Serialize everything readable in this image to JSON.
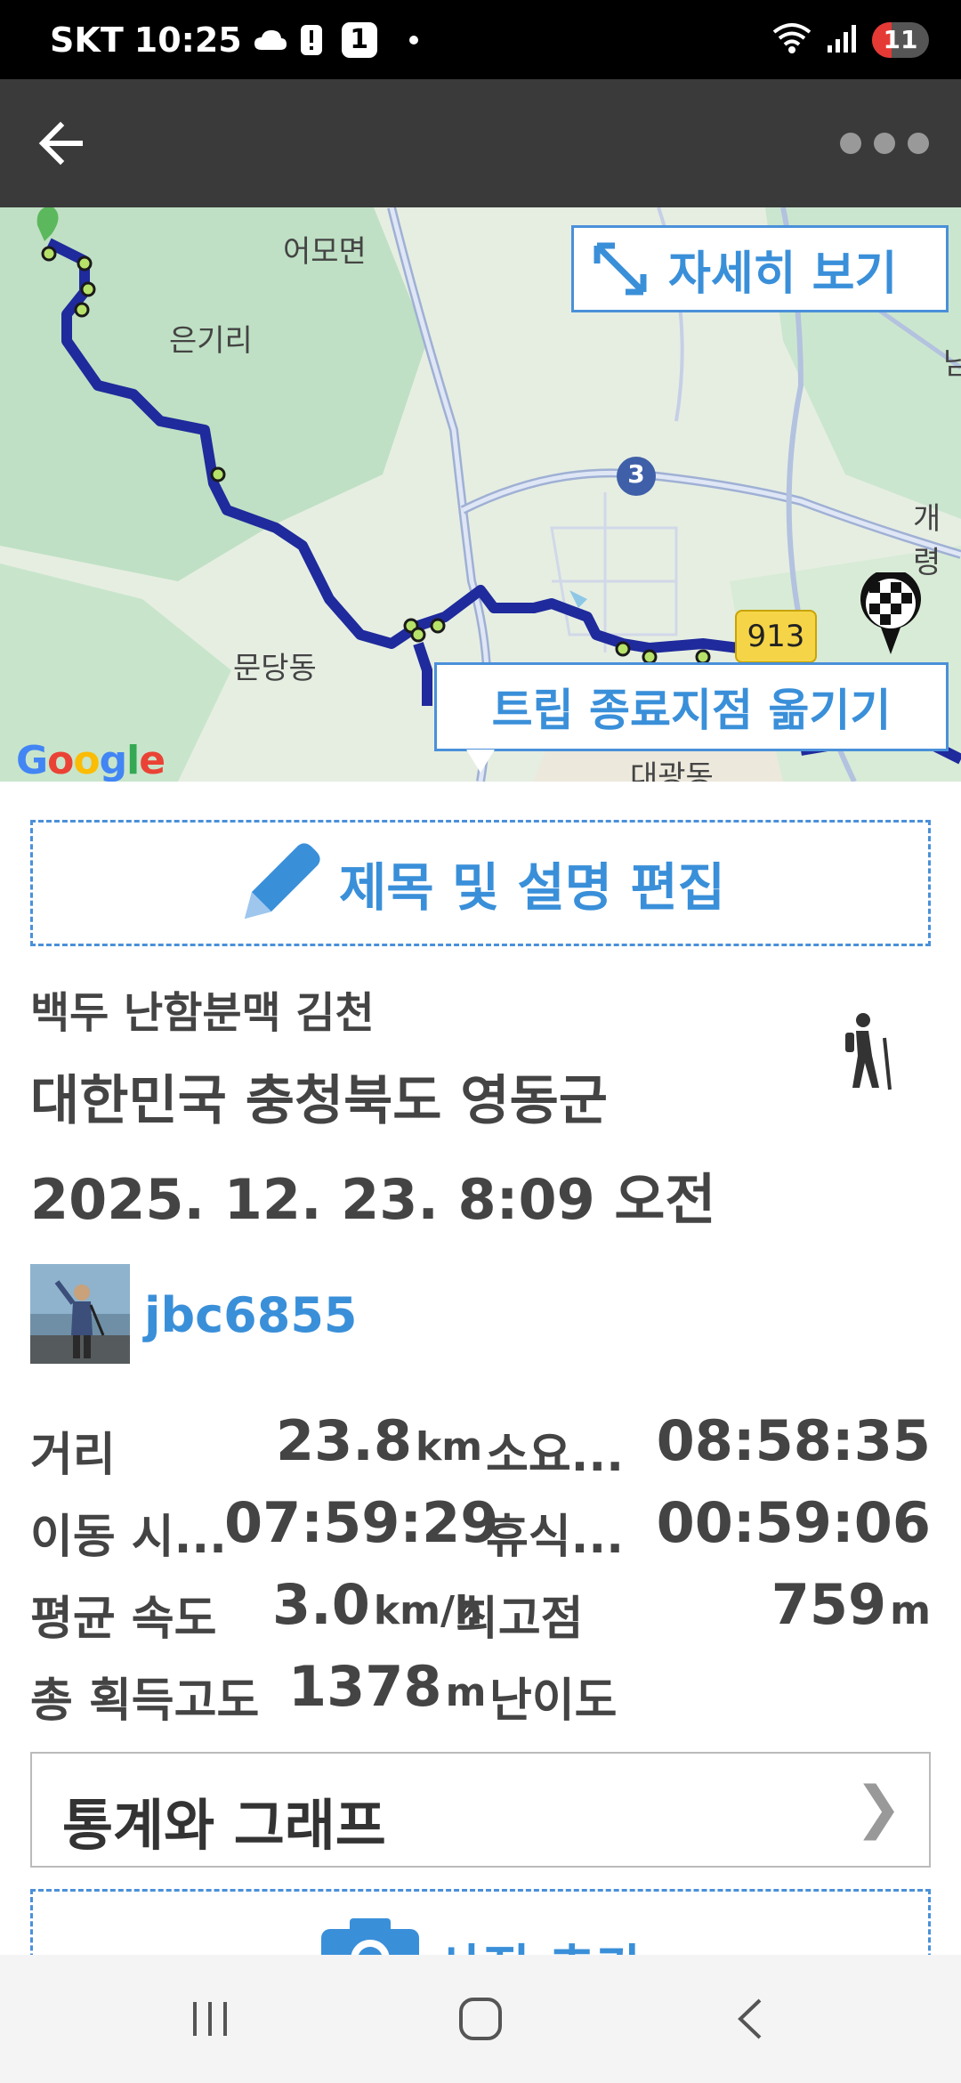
{
  "status_bar": {
    "carrier": "SKT",
    "time": "10:25",
    "notification_badge": "1",
    "battery_level": "11",
    "icons": [
      "cloud-icon",
      "alert-icon",
      "wifi-icon",
      "signal-icon"
    ]
  },
  "app_bar": {
    "back_icon": "arrow-left-icon",
    "more_icon": "more-dots-icon"
  },
  "map": {
    "labels": [
      "어모면",
      "은기리",
      "문당동",
      "대광동",
      "개령",
      "남"
    ],
    "road_number": "913",
    "route_marker": "3",
    "detail_button": "자세히 보기",
    "move_end_button": "트립 종료지점 옮기기",
    "logo": "Google",
    "route_color": "#1f2a9c"
  },
  "edit_button": "제목 및 설명 편집",
  "trip": {
    "title": "백두 난함분맥 김천",
    "location": "대한민국 충청북도 영동군",
    "date": "2025. 12. 23. 8:09 오전",
    "activity_icon": "hiker-icon"
  },
  "user": {
    "username": "jbc6855"
  },
  "stats": {
    "distance_label": "거리",
    "distance_value": "23.8",
    "distance_unit": "km",
    "duration_label": "소요...",
    "duration_value": "08:58:35",
    "moving_label": "이동 시...",
    "moving_value": "07:59:29",
    "rest_label": "휴식...",
    "rest_value": "00:59:06",
    "avg_speed_label": "평균 속도",
    "avg_speed_value": "3.0",
    "avg_speed_unit": "km/h",
    "max_elev_label": "최고점",
    "max_elev_value": "759",
    "max_elev_unit": "m",
    "gain_label": "총 획득고도",
    "gain_value": "1378",
    "gain_unit": "m",
    "difficulty_label": "난이도"
  },
  "stats_button": {
    "label": "통계와 그래프",
    "chevron": "❯"
  },
  "photo_button": {
    "label": "사진 추가"
  },
  "colors": {
    "accent": "#3a8fd9",
    "app_bar": "#3a3a3a",
    "status_bar": "#000000"
  }
}
